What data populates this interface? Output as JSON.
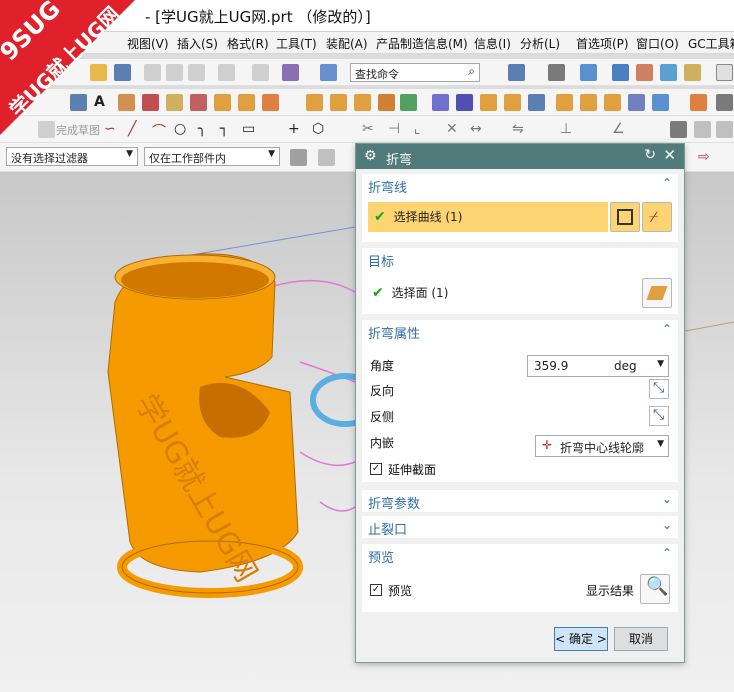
{
  "window": {
    "title": "- [学UG就上UG网.prt （修改的）]"
  },
  "logo": {
    "line1": "9SUG",
    "line2": "学UG就上UG网"
  },
  "menu": [
    "视图(V)",
    "插入(S)",
    "格式(R)",
    "工具(T)",
    "装配(A)",
    "产品制造信息(M)",
    "信息(I)",
    "分析(L)",
    "首选项(P)",
    "窗口(O)",
    "GC工具箱"
  ],
  "toolbar": {
    "search_placeholder": "查找命令",
    "finish_sketch": "完成草图"
  },
  "filters": {
    "selection_filter": "没有选择过滤器",
    "scope": "仅在工作部件内"
  },
  "dialog": {
    "title": "折弯",
    "bend_line": {
      "header": "折弯线",
      "select_label": "选择曲线 (1)"
    },
    "target": {
      "header": "目标",
      "select_label": "选择面 (1)"
    },
    "bend_props": {
      "header": "折弯属性",
      "angle_label": "角度",
      "angle_value": "359.9",
      "angle_unit": "deg",
      "reverse_label": "反向",
      "reverse_side_label": "反侧",
      "inlay_label": "内嵌",
      "inlay_value": "折弯中心线轮廓",
      "extend_label": "延伸截面",
      "extend_checked": true
    },
    "bend_params": {
      "header": "折弯参数"
    },
    "relief": {
      "header": "止裂口"
    },
    "preview": {
      "header": "预览",
      "preview_label": "预览",
      "preview_checked": true,
      "show_result_label": "显示结果"
    },
    "ok_label": "< 确定 >",
    "cancel_label": "取消"
  },
  "viewport": {
    "model_text": "学UG就上UG网",
    "model_color": "#f59a00"
  }
}
